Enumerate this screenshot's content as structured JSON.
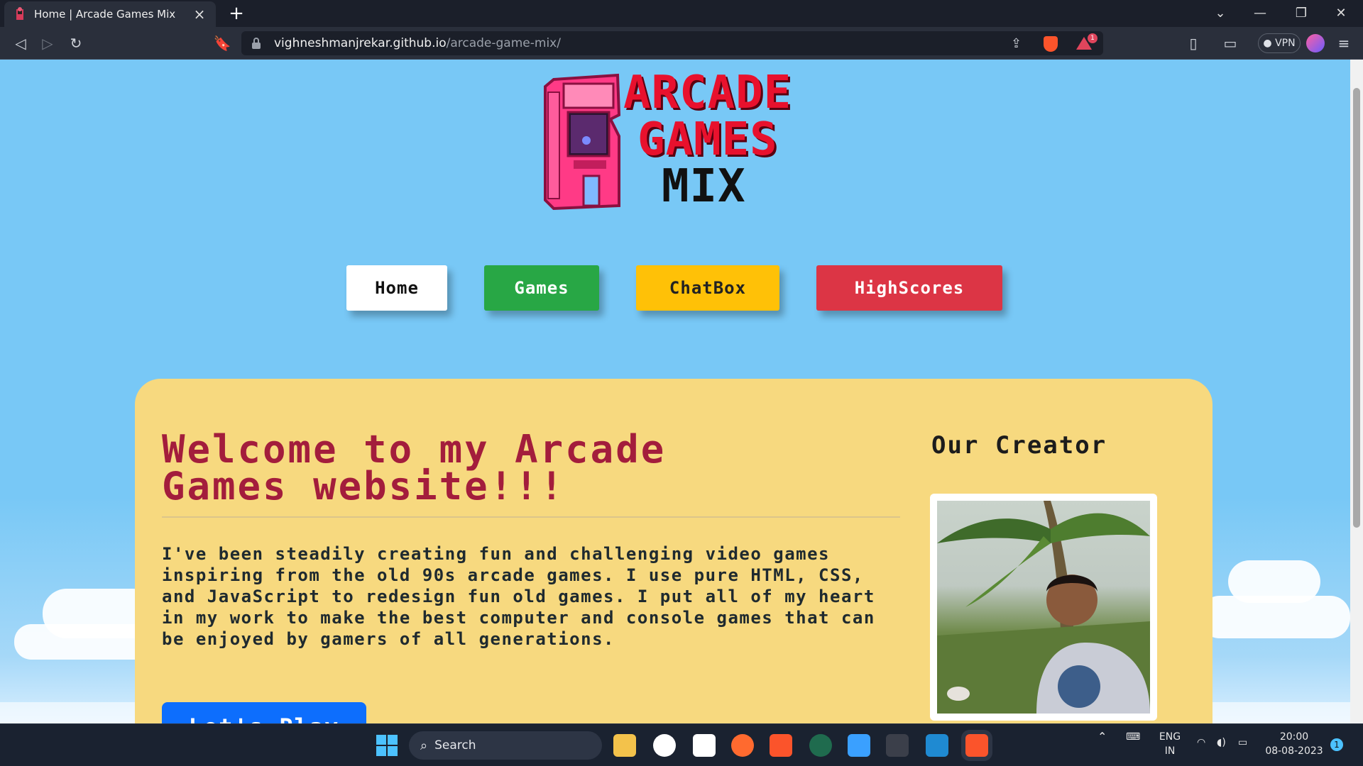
{
  "browser": {
    "tab_title": "Home | Arcade Games Mix",
    "url_host": "vighneshmanjrekar.github.io",
    "url_path": "/arcade-game-mix/",
    "vpn_label": "VPN",
    "notification_count": "1"
  },
  "logo": {
    "line1": "ARCADE",
    "line2": "GAMES",
    "line3": "MIX"
  },
  "nav": [
    {
      "label": "Home",
      "bg": "#ffffff",
      "fg": "#111111"
    },
    {
      "label": "Games",
      "bg": "#28a745",
      "fg": "#ffffff"
    },
    {
      "label": "ChatBox",
      "bg": "#ffc107",
      "fg": "#222222"
    },
    {
      "label": "HighScores",
      "bg": "#dc3545",
      "fg": "#ffffff"
    }
  ],
  "main": {
    "welcome_title": "Welcome to my Arcade Games website!!!",
    "description": "I've been steadily creating fun and challenging video games inspiring from the old 90s arcade games. I use pure HTML, CSS, and JavaScript to redesign fun old games. I put all of my heart in my work to make the best computer and console games that can be enjoyed by gamers of all generations.",
    "play_button": "Let's Play",
    "creator_heading": "Our Creator"
  },
  "taskbar": {
    "search_label": "Search",
    "lang_line1": "ENG",
    "lang_line2": "IN",
    "time": "20:00",
    "date": "08-08-2023",
    "notification_badge": "1"
  },
  "colors": {
    "page_bg": "#78c8f6",
    "card_bg": "#f7d97f",
    "title_color": "#a31d3c",
    "play_button": "#0d6efd"
  }
}
